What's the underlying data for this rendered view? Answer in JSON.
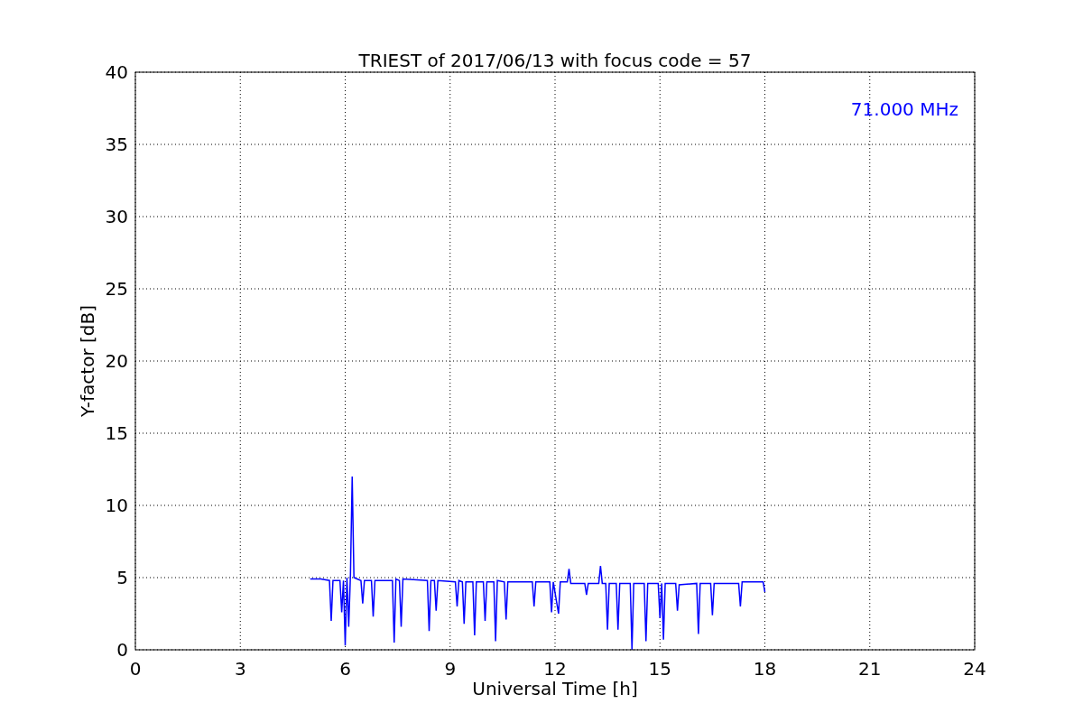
{
  "figure": {
    "chart_data": {
      "type": "line",
      "title": "TRIEST of 2017/06/13 with focus code = 57",
      "xlabel": "Universal Time [h]",
      "ylabel": "Y-factor [dB]",
      "xlim": [
        0,
        24
      ],
      "ylim": [
        0,
        40
      ],
      "xticks": [
        0,
        3,
        6,
        9,
        12,
        15,
        18,
        21,
        24
      ],
      "yticks": [
        0,
        5,
        10,
        15,
        20,
        25,
        30,
        35,
        40
      ],
      "x": [
        5.0,
        5.3,
        5.55,
        5.6,
        5.65,
        5.85,
        5.9,
        5.95,
        6.0,
        6.05,
        6.1,
        6.15,
        6.2,
        6.25,
        6.45,
        6.5,
        6.55,
        6.75,
        6.8,
        6.85,
        7.35,
        7.4,
        7.45,
        7.55,
        7.6,
        7.65,
        8.35,
        8.4,
        8.45,
        8.55,
        8.6,
        8.65,
        9.15,
        9.2,
        9.25,
        9.35,
        9.4,
        9.45,
        9.65,
        9.7,
        9.75,
        9.95,
        10.0,
        10.05,
        10.25,
        10.3,
        10.35,
        10.55,
        10.6,
        10.65,
        11.35,
        11.4,
        11.45,
        11.85,
        11.9,
        11.95,
        12.1,
        12.15,
        12.35,
        12.4,
        12.45,
        12.85,
        12.9,
        12.95,
        13.25,
        13.3,
        13.35,
        13.45,
        13.5,
        13.55,
        13.75,
        13.8,
        13.85,
        14.15,
        14.2,
        14.25,
        14.55,
        14.6,
        14.65,
        14.95,
        15.0,
        15.05,
        15.1,
        15.15,
        15.45,
        15.5,
        15.55,
        16.05,
        16.1,
        16.15,
        16.45,
        16.5,
        16.55,
        17.25,
        17.3,
        17.35,
        17.95,
        18.0
      ],
      "series": [
        {
          "name": "71.000 MHz",
          "color": "#0000ff",
          "values": [
            4.9,
            4.9,
            4.8,
            2.0,
            4.8,
            4.8,
            2.6,
            4.8,
            0.3,
            5.0,
            1.6,
            5.2,
            12.0,
            5.0,
            4.8,
            3.2,
            4.8,
            4.8,
            2.3,
            4.8,
            4.8,
            0.5,
            4.9,
            4.8,
            1.6,
            4.9,
            4.8,
            1.3,
            4.8,
            4.8,
            2.7,
            4.8,
            4.7,
            3.0,
            4.8,
            4.7,
            1.8,
            4.7,
            4.7,
            1.0,
            4.7,
            4.7,
            2.0,
            4.7,
            4.7,
            0.6,
            4.8,
            4.7,
            2.1,
            4.7,
            4.7,
            3.0,
            4.7,
            4.7,
            2.6,
            4.7,
            2.5,
            4.7,
            4.7,
            5.6,
            4.6,
            4.6,
            3.8,
            4.6,
            4.6,
            5.8,
            4.6,
            4.6,
            1.4,
            4.6,
            4.6,
            1.4,
            4.6,
            4.6,
            0.0,
            4.6,
            4.6,
            0.6,
            4.6,
            4.6,
            2.2,
            4.6,
            0.7,
            4.6,
            4.6,
            2.7,
            4.5,
            4.6,
            1.1,
            4.6,
            4.6,
            2.4,
            4.6,
            4.6,
            3.0,
            4.7,
            4.7,
            4.0
          ]
        }
      ],
      "grid": true
    }
  }
}
